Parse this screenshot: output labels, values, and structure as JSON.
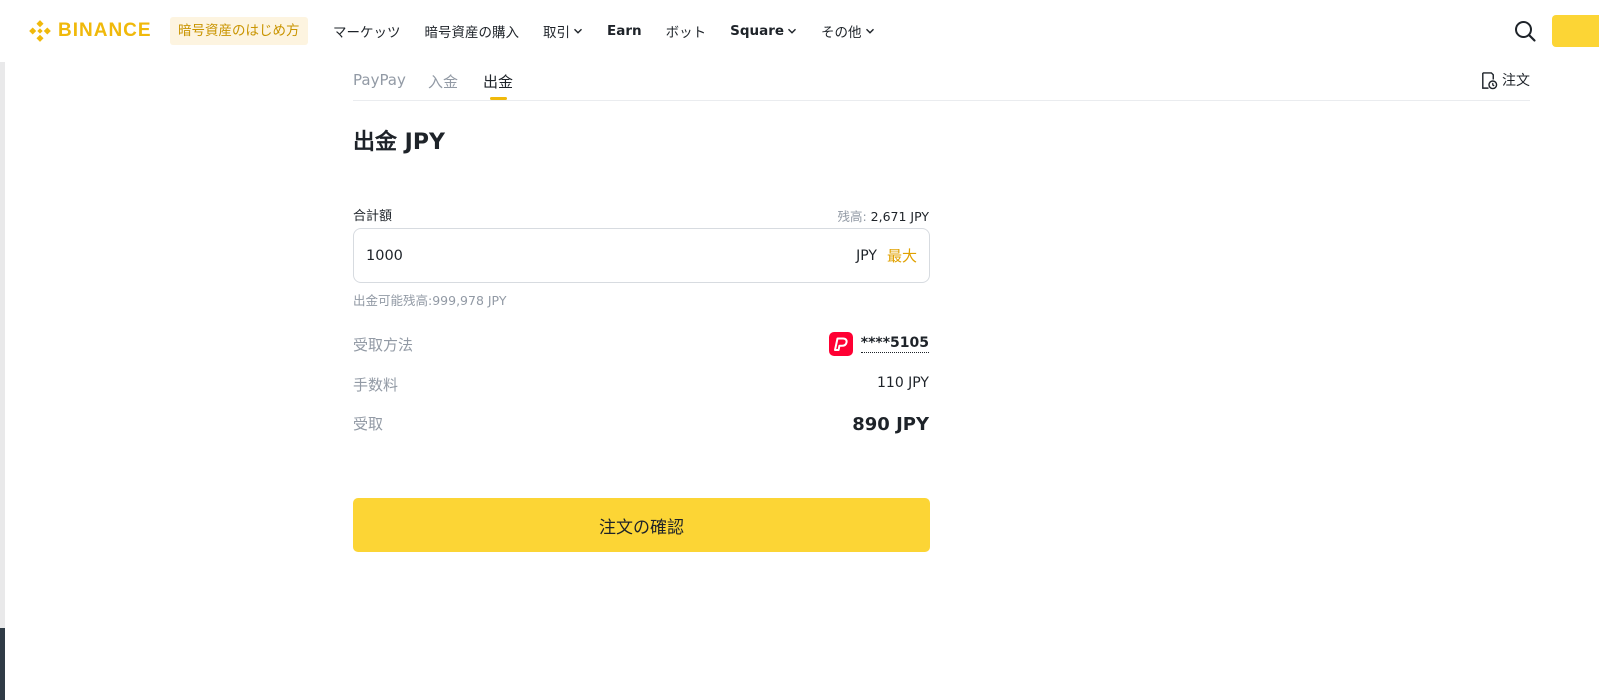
{
  "header": {
    "logo_text": "BINANCE",
    "promo_label": "暗号資産のはじめ方",
    "nav": [
      {
        "label": "マーケッツ"
      },
      {
        "label": "暗号資産の購入"
      },
      {
        "label": "取引"
      },
      {
        "label": "Earn"
      },
      {
        "label": "ボット"
      },
      {
        "label": "Square"
      },
      {
        "label": "その他"
      }
    ]
  },
  "tabs": {
    "items": [
      {
        "label": "PayPay"
      },
      {
        "label": "入金"
      },
      {
        "label": "出金"
      }
    ],
    "active": "出金",
    "orders_label": "注文"
  },
  "withdraw": {
    "title": "出金 JPY",
    "amount_label": "合計額",
    "balance_label": "残高:",
    "balance_value": "2,671 JPY",
    "amount_value": "1000",
    "currency": "JPY",
    "max_label": "最大",
    "available_text": "出金可能残高:999,978 JPY",
    "method_label": "受取方法",
    "method_account": "****5105",
    "fee_label": "手数料",
    "fee_value": "110 JPY",
    "receive_label": "受取",
    "receive_value": "890 JPY",
    "confirm_label": "注文の確認"
  },
  "colors": {
    "brand": "#f0b90b",
    "button": "#fcd535",
    "paypay": "#ff0033",
    "muted": "#929aa5",
    "text": "#1e2329"
  }
}
